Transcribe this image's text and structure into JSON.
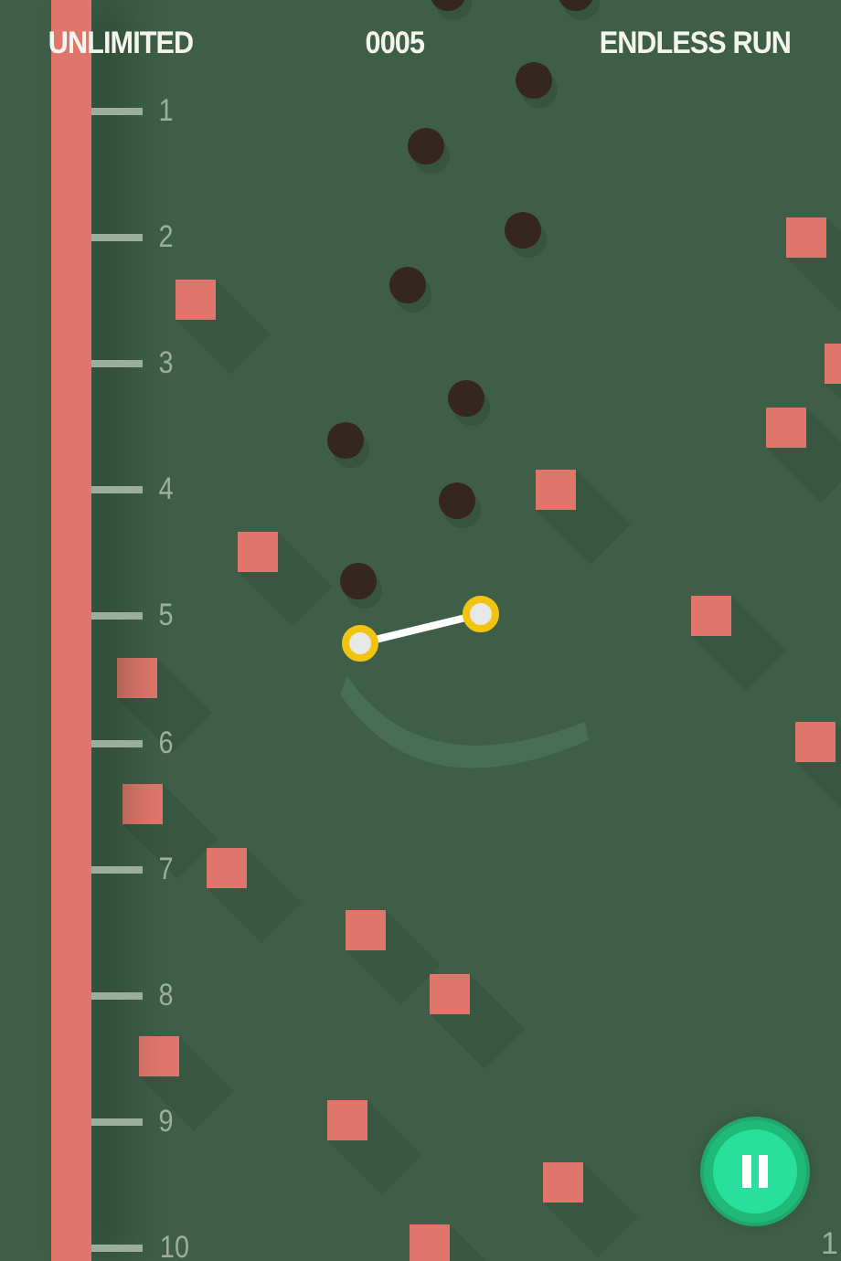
{
  "hud": {
    "mode": "UNLIMITED",
    "score": "0005",
    "run_type": "ENDLESS RUN"
  },
  "ruler": {
    "marks": [
      "1",
      "2",
      "3",
      "4",
      "5",
      "6",
      "7",
      "8",
      "9",
      "10"
    ]
  },
  "edge_label": "1"
}
